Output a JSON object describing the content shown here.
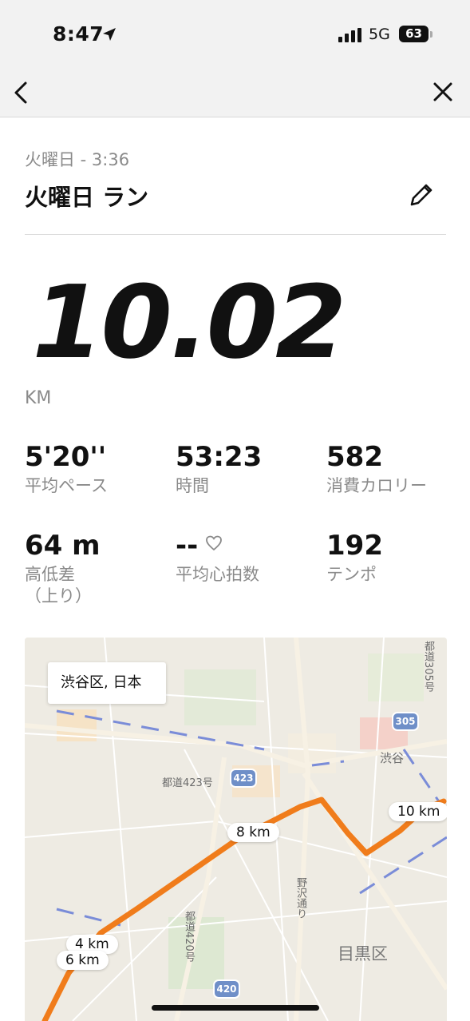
{
  "status_bar": {
    "time": "8:47",
    "network": "5G",
    "battery": "63"
  },
  "header": {
    "subtitle": "火曜日 - 3:36",
    "title": "火曜日 ラン"
  },
  "summary": {
    "distance": "10.02",
    "unit": "KM"
  },
  "stats": [
    {
      "value": "5'20''",
      "label": "平均ペース"
    },
    {
      "value": "53:23",
      "label": "時間"
    },
    {
      "value": "582",
      "label": "消費カロリー"
    },
    {
      "value": "64 m",
      "label": "高低差\n（上り）"
    },
    {
      "value": "--",
      "label": "平均心拍数"
    },
    {
      "value": "192",
      "label": "テンポ"
    }
  ],
  "map": {
    "location": "渋谷区, 日本",
    "km_markers": [
      "10 km",
      "8 km",
      "4 km",
      "6 km"
    ],
    "labels": {
      "road_423": "都道423号",
      "road_305": "都道305号",
      "road_420": "都道420号",
      "shibuya": "渋谷",
      "nozawa": "野沢通り",
      "meguro": "目黒区"
    },
    "shields": [
      "305",
      "423",
      "420"
    ],
    "route_color": "#f07c1b"
  },
  "icons": [
    "location-arrow-icon",
    "signal-icon",
    "battery-icon",
    "back-chevron-icon",
    "close-icon",
    "pencil-icon",
    "heart-icon"
  ]
}
